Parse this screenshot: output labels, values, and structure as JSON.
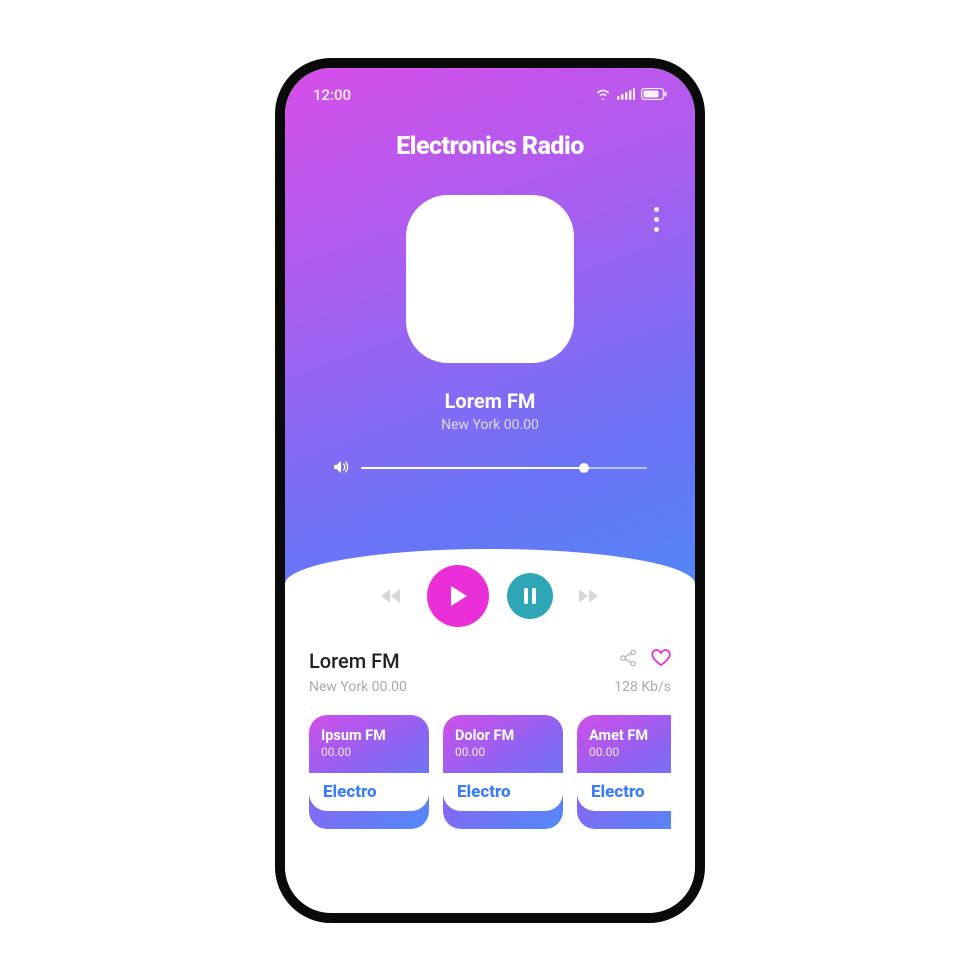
{
  "colors": {
    "gradient_start": "#d64fe8",
    "gradient_end": "#4e8bf8",
    "play": "#ea2fd9",
    "pause": "#2fa6b6",
    "accent_blue": "#3a7ef5"
  },
  "status": {
    "time": "12:00",
    "icons": {
      "wifi": "wifi-icon",
      "signal": "signal-icon",
      "battery": "battery-icon"
    }
  },
  "header": {
    "title": "Electronics Radio"
  },
  "now_playing": {
    "artwork_icon": "waveform-icon",
    "title": "Lorem FM",
    "subtitle": "New York 00.00"
  },
  "volume": {
    "level_percent": 78
  },
  "controls": {
    "previous": "previous-icon",
    "play": "play-icon",
    "pause": "pause-icon",
    "next": "next-icon"
  },
  "track_info": {
    "title": "Lorem FM",
    "subtitle": "New York 00.00",
    "bitrate": "128 Kb/s",
    "actions": {
      "share": "share-icon",
      "favorite": "heart-icon"
    }
  },
  "stations": [
    {
      "name": "Ipsum FM",
      "frequency": "00.00",
      "genre": "Electro"
    },
    {
      "name": "Dolor FM",
      "frequency": "00.00",
      "genre": "Electro"
    },
    {
      "name": "Amet FM",
      "frequency": "00.00",
      "genre": "Electro"
    }
  ]
}
